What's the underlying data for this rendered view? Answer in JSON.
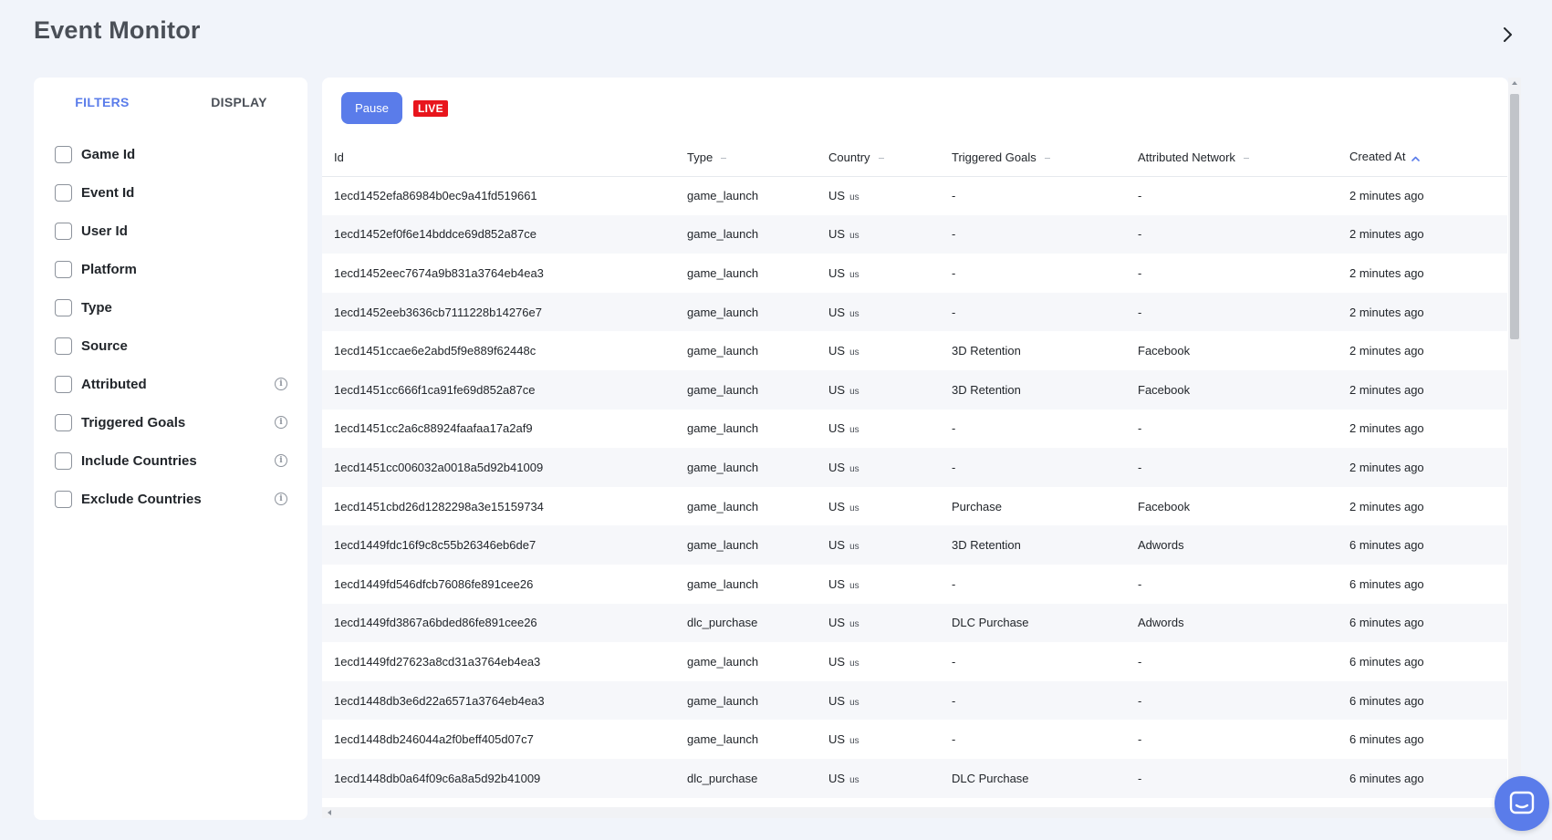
{
  "page": {
    "title": "Event Monitor"
  },
  "filters_panel": {
    "tabs": [
      {
        "label": "FILTERS",
        "active": true
      },
      {
        "label": "DISPLAY",
        "active": false
      }
    ],
    "filters": [
      {
        "label": "Game Id",
        "checked": false,
        "info": false
      },
      {
        "label": "Event Id",
        "checked": false,
        "info": false
      },
      {
        "label": "User Id",
        "checked": false,
        "info": false
      },
      {
        "label": "Platform",
        "checked": false,
        "info": false
      },
      {
        "label": "Type",
        "checked": false,
        "info": false
      },
      {
        "label": "Source",
        "checked": false,
        "info": false
      },
      {
        "label": "Attributed",
        "checked": false,
        "info": true
      },
      {
        "label": "Triggered Goals",
        "checked": false,
        "info": true
      },
      {
        "label": "Include Countries",
        "checked": false,
        "info": true
      },
      {
        "label": "Exclude Countries",
        "checked": false,
        "info": true
      }
    ]
  },
  "toolbar": {
    "pause_label": "Pause",
    "live_label": "LIVE"
  },
  "table": {
    "columns": [
      {
        "label": "Id",
        "sort": "none-hidden"
      },
      {
        "label": "Type",
        "sort": "none"
      },
      {
        "label": "Country",
        "sort": "none"
      },
      {
        "label": "Triggered Goals",
        "sort": "none"
      },
      {
        "label": "Attributed Network",
        "sort": "none"
      },
      {
        "label": "Created At",
        "sort": "asc"
      }
    ],
    "rows": [
      {
        "id": "1ecd1452efa86984b0ec9a41fd519661",
        "type": "game_launch",
        "country": "US",
        "country_small": "us",
        "goals": "-",
        "network": "-",
        "created": "2 minutes ago"
      },
      {
        "id": "1ecd1452ef0f6e14bddce69d852a87ce",
        "type": "game_launch",
        "country": "US",
        "country_small": "us",
        "goals": "-",
        "network": "-",
        "created": "2 minutes ago"
      },
      {
        "id": "1ecd1452eec7674a9b831a3764eb4ea3",
        "type": "game_launch",
        "country": "US",
        "country_small": "us",
        "goals": "-",
        "network": "-",
        "created": "2 minutes ago"
      },
      {
        "id": "1ecd1452eeb3636cb7111228b14276e7",
        "type": "game_launch",
        "country": "US",
        "country_small": "us",
        "goals": "-",
        "network": "-",
        "created": "2 minutes ago"
      },
      {
        "id": "1ecd1451ccae6e2abd5f9e889f62448c",
        "type": "game_launch",
        "country": "US",
        "country_small": "us",
        "goals": "3D Retention",
        "network": "Facebook",
        "created": "2 minutes ago"
      },
      {
        "id": "1ecd1451cc666f1ca91fe69d852a87ce",
        "type": "game_launch",
        "country": "US",
        "country_small": "us",
        "goals": "3D Retention",
        "network": "Facebook",
        "created": "2 minutes ago"
      },
      {
        "id": "1ecd1451cc2a6c88924faafaa17a2af9",
        "type": "game_launch",
        "country": "US",
        "country_small": "us",
        "goals": "-",
        "network": "-",
        "created": "2 minutes ago"
      },
      {
        "id": "1ecd1451cc006032a0018a5d92b41009",
        "type": "game_launch",
        "country": "US",
        "country_small": "us",
        "goals": "-",
        "network": "-",
        "created": "2 minutes ago"
      },
      {
        "id": "1ecd1451cbd26d1282298a3e15159734",
        "type": "game_launch",
        "country": "US",
        "country_small": "us",
        "goals": "Purchase",
        "network": "Facebook",
        "created": "2 minutes ago"
      },
      {
        "id": "1ecd1449fdc16f9c8c55b26346eb6de7",
        "type": "game_launch",
        "country": "US",
        "country_small": "us",
        "goals": "3D Retention",
        "network": "Adwords",
        "created": "6 minutes ago"
      },
      {
        "id": "1ecd1449fd546dfcb76086fe891cee26",
        "type": "game_launch",
        "country": "US",
        "country_small": "us",
        "goals": "-",
        "network": "-",
        "created": "6 minutes ago"
      },
      {
        "id": "1ecd1449fd3867a6bded86fe891cee26",
        "type": "dlc_purchase",
        "country": "US",
        "country_small": "us",
        "goals": "DLC Purchase",
        "network": "Adwords",
        "created": "6 minutes ago"
      },
      {
        "id": "1ecd1449fd27623a8cd31a3764eb4ea3",
        "type": "game_launch",
        "country": "US",
        "country_small": "us",
        "goals": "-",
        "network": "-",
        "created": "6 minutes ago"
      },
      {
        "id": "1ecd1448db3e6d22a6571a3764eb4ea3",
        "type": "game_launch",
        "country": "US",
        "country_small": "us",
        "goals": "-",
        "network": "-",
        "created": "6 minutes ago"
      },
      {
        "id": "1ecd1448db246044a2f0beff405d07c7",
        "type": "game_launch",
        "country": "US",
        "country_small": "us",
        "goals": "-",
        "network": "-",
        "created": "6 minutes ago"
      },
      {
        "id": "1ecd1448db0a64f09c6a8a5d92b41009",
        "type": "dlc_purchase",
        "country": "US",
        "country_small": "us",
        "goals": "DLC Purchase",
        "network": "-",
        "created": "6 minutes ago"
      }
    ]
  },
  "icons": {
    "collapse": "chevron-right-icon",
    "info": "info-icon",
    "sort_asc": "chevron-up-icon",
    "chat": "chat-launcher-icon"
  },
  "colors": {
    "accent": "#5a7cea",
    "live": "#e8151c",
    "background": "#f1f4fa",
    "row_alt": "#f6f7fa"
  }
}
